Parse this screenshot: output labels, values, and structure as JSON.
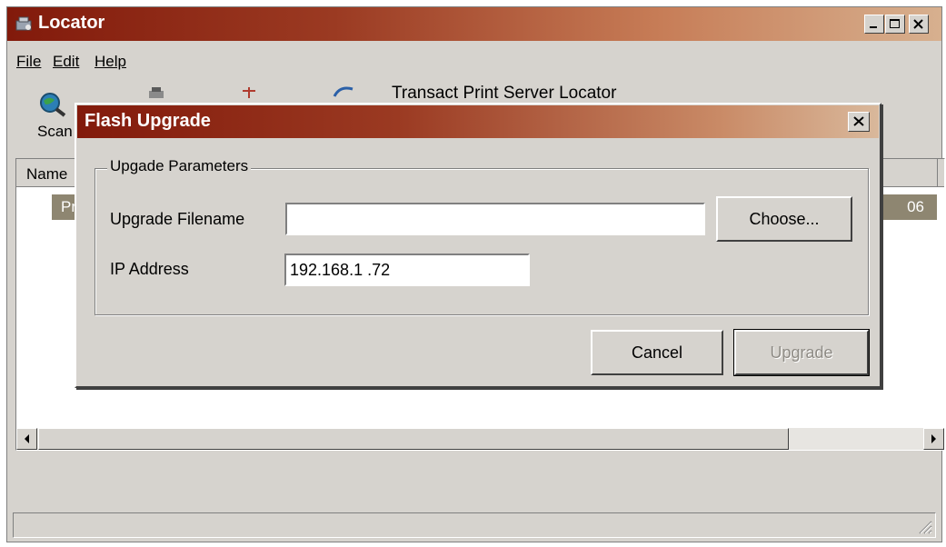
{
  "main_window": {
    "title": "Locator",
    "menu": [
      "File",
      "Edit",
      "Help"
    ],
    "toolbar": {
      "scan_label": "Scan",
      "caption": "Transact Print Server Locator"
    },
    "list": {
      "columns": [
        "Name"
      ],
      "rows": [
        {
          "left": "Pr",
          "right": "06"
        }
      ]
    }
  },
  "dialog": {
    "title": "Flash Upgrade",
    "group_title": "Upgade Parameters",
    "filename_label": "Upgrade Filename",
    "filename_value": "",
    "choose_label": "Choose...",
    "ip_label": "IP Address",
    "ip_value": "192.168.1 .72",
    "cancel_label": "Cancel",
    "upgrade_label": "Upgrade"
  },
  "colors": {
    "title_gradient_start": "#821a0b",
    "selection": "#8e8671",
    "face": "#d6d3ce"
  }
}
